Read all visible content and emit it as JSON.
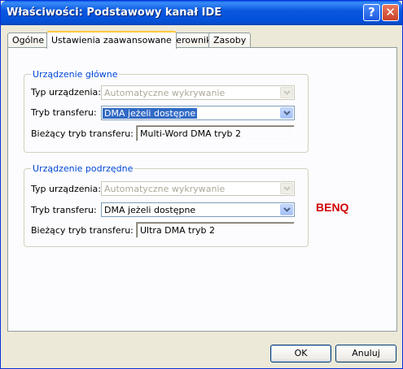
{
  "window": {
    "title": "Właściwości: Podstawowy kanał IDE",
    "help_glyph": "?",
    "close_glyph": "✕"
  },
  "tabs": [
    {
      "label": "Ogólne",
      "active": false
    },
    {
      "label": "Ustawienia zaawansowane",
      "active": true
    },
    {
      "label": "Sterownik",
      "active": false
    },
    {
      "label": "Zasoby",
      "active": false
    }
  ],
  "primary": {
    "legend": "Urządzenie główne",
    "device_type_label": "Typ urządzenia:",
    "device_type_value": "Automatyczne wykrywanie",
    "transfer_mode_label": "Tryb transferu:",
    "transfer_mode_value": "DMA jeżeli dostępne",
    "current_mode_label": "Bieżący tryb transferu:",
    "current_mode_value": "Multi-Word DMA tryb 2"
  },
  "secondary": {
    "legend": "Urządzenie podrzędne",
    "device_type_label": "Typ urządzenia:",
    "device_type_value": "Automatyczne wykrywanie",
    "transfer_mode_label": "Tryb transferu:",
    "transfer_mode_value": "DMA jeżeli dostępne",
    "current_mode_label": "Bieżący tryb transferu:",
    "current_mode_value": "Ultra DMA tryb 2"
  },
  "annotation": "BENQ",
  "buttons": {
    "ok": "OK",
    "cancel": "Anuluj"
  },
  "colors": {
    "titlebar": "#0a58e0",
    "legend": "#0046d5",
    "annotation": "#d00000",
    "selection": "#316ac5"
  }
}
